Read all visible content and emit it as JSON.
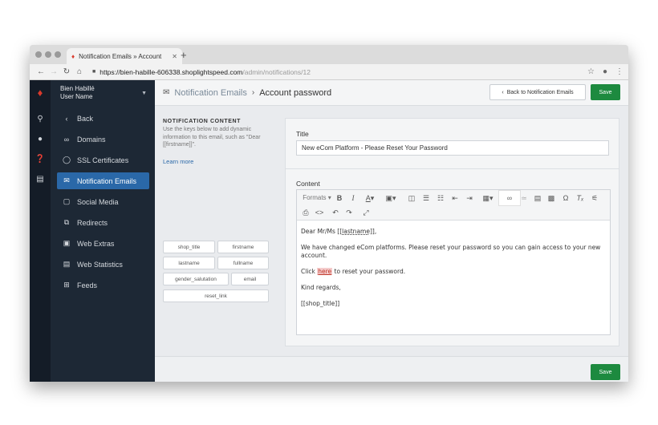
{
  "browser": {
    "tab_title": "Notification Emails » Account",
    "url_host": "https://bien-habille-606338.shoplightspeed.com",
    "url_path": "/admin/notifications/12"
  },
  "sidebar": {
    "store_name": "Bien Habillé",
    "user_name": "User Name",
    "items": [
      {
        "label": "Back",
        "icon": "chevron-left-icon"
      },
      {
        "label": "Domains",
        "icon": "link-icon"
      },
      {
        "label": "SSL Certificates",
        "icon": "shield-icon"
      },
      {
        "label": "Notification Emails",
        "icon": "mail-icon",
        "active": true
      },
      {
        "label": "Social Media",
        "icon": "chat-icon"
      },
      {
        "label": "Redirects",
        "icon": "redirect-icon"
      },
      {
        "label": "Web Extras",
        "icon": "extras-icon"
      },
      {
        "label": "Web Statistics",
        "icon": "stats-icon"
      },
      {
        "label": "Feeds",
        "icon": "feeds-icon"
      }
    ]
  },
  "header": {
    "breadcrumb_parent": "Notification Emails",
    "breadcrumb_current": "Account password",
    "back_button": "Back to Notification Emails",
    "save_button": "Save"
  },
  "notification_content": {
    "title": "NOTIFICATION CONTENT",
    "description": "Use the keys below to add dynamic information to this email, such as \"Dear [[firstname]]\".",
    "learn_more": "Learn more",
    "keys": [
      "shop_title",
      "firstname",
      "lastname",
      "fullname",
      "gender_salutation",
      "email",
      "reset_link"
    ]
  },
  "form": {
    "title_label": "Title",
    "title_value": "New eCom Platform - Please Reset Your Password",
    "content_label": "Content",
    "toolbar_formats": "Formats"
  },
  "editor_content": {
    "line1_prefix": "Dear Mr/Ms [[",
    "line1_key": "lastname",
    "line1_suffix": "]],",
    "line2": "We have changed eCom platforms. Please reset your password so you can gain access to your new account.",
    "line3_prefix": "Click ",
    "line3_link": "here",
    "line3_suffix": " to reset your password.",
    "line4": "Kind regards,",
    "line5": "[[shop_title]]"
  },
  "footer": {
    "save_button": "Save"
  },
  "colors": {
    "accent_green": "#1d8a3f",
    "sidebar_active": "#2a68a8",
    "sidebar_bg": "#1d2835",
    "rail_bg": "#141c27"
  }
}
